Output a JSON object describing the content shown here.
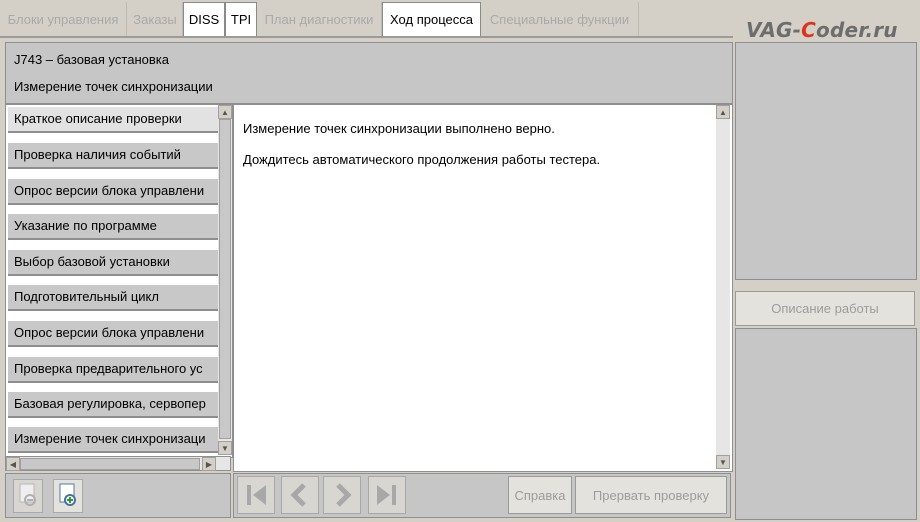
{
  "tabs": [
    {
      "label": "Блоки управления",
      "active": false
    },
    {
      "label": "Заказы",
      "active": false
    },
    {
      "label": "DISS",
      "active": true
    },
    {
      "label": "TPI",
      "active": true
    },
    {
      "label": "План диагностики",
      "active": false
    },
    {
      "label": "Ход процесса",
      "active": true
    },
    {
      "label": "Специальные функции",
      "active": false
    }
  ],
  "watermark": {
    "pre": "VAG-",
    "accent": "C",
    "post": "oder.ru"
  },
  "header": {
    "unit": "J743 – базовая установка",
    "operation": "Измерение точек синхронизации"
  },
  "steps": [
    "Краткое описание проверки",
    "Проверка наличия событий",
    "Опрос версии блока управлени",
    "Указание по программе",
    "Выбор базовой установки",
    "Подготовительный цикл",
    "Опрос версии блока управлени",
    "Проверка предварительного ус",
    "Базовая регулировка, сервопер",
    "Измерение точек синхронизаци"
  ],
  "main": {
    "line1": "Измерение точек синхронизации выполнено верно.",
    "line2": "Дождитесь автоматического продолжения работы тестера."
  },
  "right": {
    "work_description": "Описание работы"
  },
  "footer": {
    "help": "Справка",
    "abort": "Прервать проверку"
  },
  "colors": {
    "background": "#d4d0c8",
    "panel": "#c6c6c6",
    "step": "#c8c8c8",
    "disabled_text": "#9c9c9c",
    "logo_accent": "#e0311a"
  }
}
